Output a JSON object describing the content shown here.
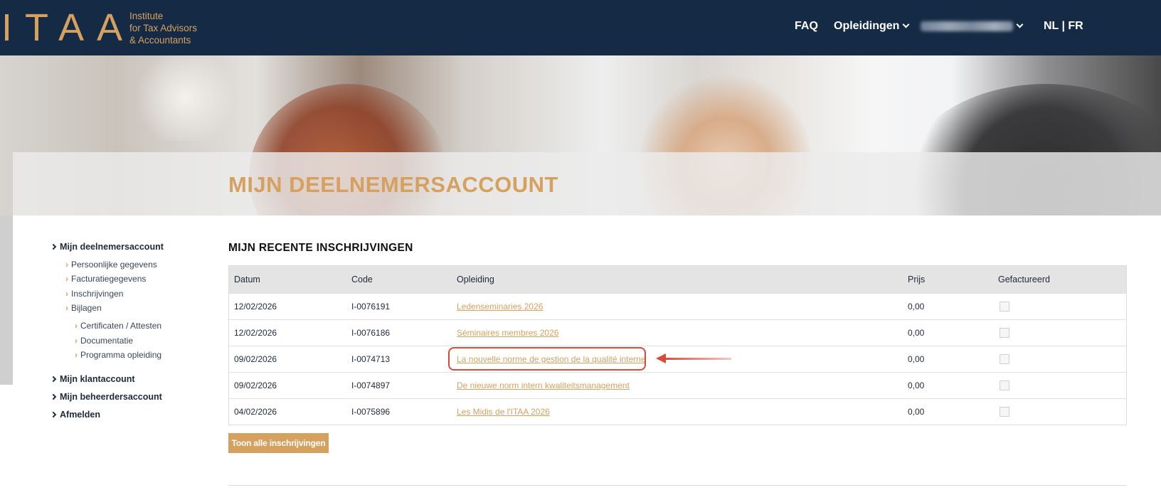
{
  "header": {
    "logo": "ITAA",
    "tagline": [
      "Institute",
      "for Tax Advisors",
      "& Accountants"
    ],
    "nav": {
      "faq": "FAQ",
      "opleidingen": "Opleidingen",
      "lang": "NL | FR"
    }
  },
  "hero": {
    "title": "MIJN DEELNEMERSACCOUNT"
  },
  "sidebar": {
    "main1": "Mijn deelnemersaccount",
    "sub": [
      "Persoonlijke gegevens",
      "Facturatiegegevens",
      "Inschrijvingen",
      "Bijlagen"
    ],
    "subsub": [
      "Certificaten / Attesten",
      "Documentatie",
      "Programma opleiding"
    ],
    "main2": "Mijn klantaccount",
    "main3": "Mijn beheerdersaccount",
    "main4": "Afmelden"
  },
  "content": {
    "section_title": "MIJN RECENTE INSCHRIJVINGEN",
    "columns": [
      "Datum",
      "Code",
      "Opleiding",
      "Prijs",
      "Gefactureerd"
    ],
    "rows": [
      {
        "datum": "12/02/2026",
        "code": "I-0076191",
        "opleiding": "Ledenseminaries 2026",
        "prijs": "0,00"
      },
      {
        "datum": "12/02/2026",
        "code": "I-0076186",
        "opleiding": "Séminaires membres 2026",
        "prijs": "0,00"
      },
      {
        "datum": "09/02/2026",
        "code": "I-0074713",
        "opleiding": "La nouvelle norme de gestion de la qualité interne",
        "prijs": "0,00"
      },
      {
        "datum": "09/02/2026",
        "code": "I-0074897",
        "opleiding": "De nieuwe norm intern kwaliteitsmanagement",
        "prijs": "0,00"
      },
      {
        "datum": "04/02/2026",
        "code": "I-0075896",
        "opleiding": "Les Midis de l'ITAA 2026",
        "prijs": "0,00"
      }
    ],
    "button": "Toon alle inschrijvingen"
  },
  "colors": {
    "navy": "#152a45",
    "gold": "#d6a15f",
    "annotation_red": "#d94a3a"
  }
}
